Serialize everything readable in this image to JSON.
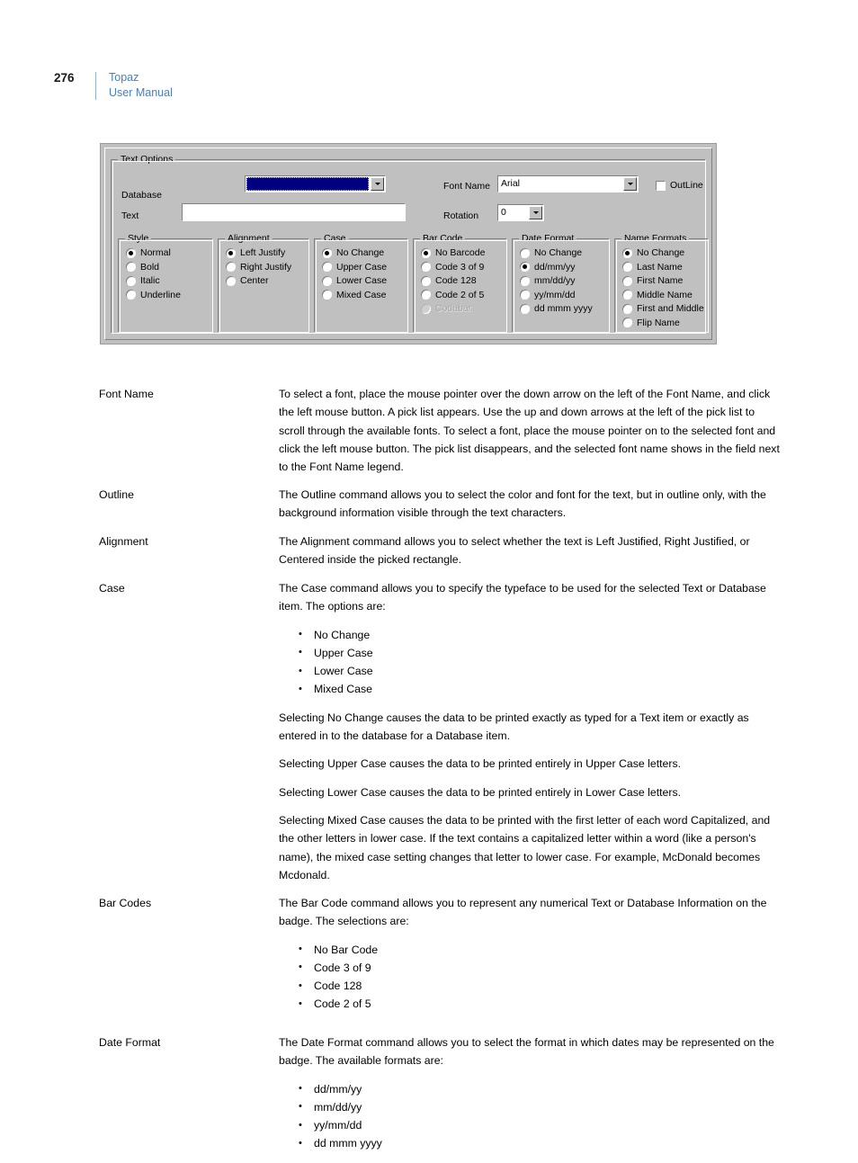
{
  "header": {
    "page_number": "276",
    "title_line1": "Topaz",
    "title_line2": "User Manual",
    "accent_color": "#4a7ebb"
  },
  "dialog": {
    "group_title": "Text Options",
    "database_label": "Database",
    "database_value": "",
    "text_label": "Text",
    "text_value": "",
    "font_name_label": "Font Name",
    "font_name_value": "Arial",
    "rotation_label": "Rotation",
    "rotation_value": "0",
    "outline_label": "OutLine",
    "outline_checked": false,
    "selection_color": "#000080",
    "groups": [
      {
        "title": "Style",
        "options": [
          {
            "label": "Normal",
            "selected": true,
            "disabled": false
          },
          {
            "label": "Bold",
            "selected": false,
            "disabled": false
          },
          {
            "label": "Italic",
            "selected": false,
            "disabled": false
          },
          {
            "label": "Underline",
            "selected": false,
            "disabled": false
          }
        ]
      },
      {
        "title": "Alignment",
        "options": [
          {
            "label": "Left Justify",
            "selected": true,
            "disabled": false
          },
          {
            "label": "Right Justify",
            "selected": false,
            "disabled": false
          },
          {
            "label": "Center",
            "selected": false,
            "disabled": false
          }
        ]
      },
      {
        "title": "Case",
        "options": [
          {
            "label": "No Change",
            "selected": true,
            "disabled": false
          },
          {
            "label": "Upper Case",
            "selected": false,
            "disabled": false
          },
          {
            "label": "Lower Case",
            "selected": false,
            "disabled": false
          },
          {
            "label": "Mixed Case",
            "selected": false,
            "disabled": false
          }
        ]
      },
      {
        "title": "Bar Code",
        "options": [
          {
            "label": "No Barcode",
            "selected": true,
            "disabled": false
          },
          {
            "label": "Code 3 of 9",
            "selected": false,
            "disabled": false
          },
          {
            "label": "Code 128",
            "selected": false,
            "disabled": false
          },
          {
            "label": "Code 2 of 5",
            "selected": false,
            "disabled": false
          },
          {
            "label": "Codabar",
            "selected": false,
            "disabled": true
          }
        ]
      },
      {
        "title": "Date Format",
        "options": [
          {
            "label": "No Change",
            "selected": false,
            "disabled": false
          },
          {
            "label": "dd/mm/yy",
            "selected": true,
            "disabled": false
          },
          {
            "label": "mm/dd/yy",
            "selected": false,
            "disabled": false
          },
          {
            "label": "yy/mm/dd",
            "selected": false,
            "disabled": false
          },
          {
            "label": "dd mmm yyyy",
            "selected": false,
            "disabled": false
          }
        ]
      },
      {
        "title": "Name Formats",
        "options": [
          {
            "label": "No Change",
            "selected": true,
            "disabled": false
          },
          {
            "label": "Last Name",
            "selected": false,
            "disabled": false
          },
          {
            "label": "First Name",
            "selected": false,
            "disabled": false
          },
          {
            "label": "Middle Name",
            "selected": false,
            "disabled": false
          },
          {
            "label": "First and Middle",
            "selected": false,
            "disabled": false
          },
          {
            "label": "Flip Name",
            "selected": false,
            "disabled": false
          }
        ]
      }
    ]
  },
  "definitions": [
    {
      "term": "Font Name",
      "paragraphs": [
        "To select a font, place the mouse pointer over the down arrow on the left of the Font Name, and click the left mouse button. A pick list appears. Use the up and down arrows at the left of the pick list to scroll through the available fonts. To select a font, place the mouse pointer on to the selected font and click the left mouse button. The pick list disappears, and the selected font name shows in the field next to the Font Name legend."
      ],
      "bullets": [],
      "after_paragraphs": []
    },
    {
      "term": "Outline",
      "paragraphs": [
        "The Outline command allows you to select the color and font for the text, but in outline only, with the background information visible through the text characters."
      ],
      "bullets": [],
      "after_paragraphs": []
    },
    {
      "term": "Alignment",
      "paragraphs": [
        "The Alignment command allows you to select whether the text is Left Justified, Right Justified, or Centered inside the picked rectangle."
      ],
      "bullets": [],
      "after_paragraphs": []
    },
    {
      "term": "Case",
      "paragraphs": [
        "The Case command allows you to specify the typeface to be used for the selected Text or Database item. The options are:"
      ],
      "bullets": [
        "No Change",
        "Upper Case",
        "Lower Case",
        "Mixed Case"
      ],
      "after_paragraphs": [
        "Selecting No Change causes the data to be printed exactly as typed for a Text item or exactly as entered in to the database for a Database item.",
        "Selecting Upper Case causes the data to be printed entirely in Upper Case letters.",
        "Selecting Lower Case causes the data to be printed entirely in Lower Case letters.",
        "Selecting Mixed Case causes the data to be printed with the first letter of each word Capitalized, and the other letters in lower case. If the text contains a capitalized letter within a word (like a person's name), the mixed case setting changes that letter to lower case. For example, McDonald becomes Mcdonald."
      ]
    },
    {
      "term": "Bar Codes",
      "paragraphs": [
        "The Bar Code command allows you to represent any numerical Text or Database Information on the badge. The selections are:"
      ],
      "bullets": [
        "No Bar Code",
        "Code 3 of 9",
        "Code 128",
        "Code 2 of 5"
      ],
      "after_paragraphs": []
    },
    {
      "term": "Date Format",
      "paragraphs": [
        "The Date Format command allows you to select the format in which dates may be represented on the badge. The available formats are:"
      ],
      "bullets": [
        "dd/mm/yy",
        "mm/dd/yy",
        "yy/mm/dd",
        "dd mmm yyyy"
      ],
      "after_paragraphs": []
    }
  ]
}
